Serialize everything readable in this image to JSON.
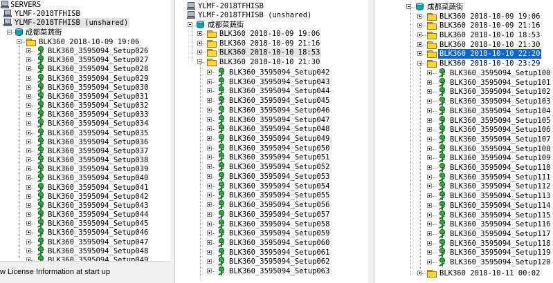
{
  "panel1": {
    "servers_label": "SERVERS",
    "server1": "YLMF-2018TFHISB",
    "server2": "YLMF-2018TFHISB (unshared)",
    "database": "成都菜蔬街",
    "project": "BLK360 2018-10-09 19:06",
    "setups": [
      "BLK360_3595094_Setup026",
      "BLK360_3595094_Setup027",
      "BLK360_3595094_Setup028",
      "BLK360_3595094_Setup029",
      "BLK360_3595094_Setup030",
      "BLK360_3595094_Setup031",
      "BLK360_3595094_Setup032",
      "BLK360_3595094_Setup033",
      "BLK360_3595094_Setup034",
      "BLK360_3595094_Setup035",
      "BLK360_3595094_Setup036",
      "BLK360_3595094_Setup037",
      "BLK360_3595094_Setup038",
      "BLK360_3595094_Setup039",
      "BLK360_3595094_Setup040",
      "BLK360_3595094_Setup041",
      "BLK360_3595094_Setup042",
      "BLK360_3595094_Setup043",
      "BLK360_3595094_Setup044",
      "BLK360_3595094_Setup045",
      "BLK360_3595094_Setup046",
      "BLK360_3595094_Setup047",
      "BLK360_3595094_Setup048",
      "BLK360_3595094_Setup049"
    ],
    "license_text": "w License Information at start up"
  },
  "panel2": {
    "server1": "YLMF-2018TFHISB",
    "server2": "YLMF-2018TFHISB (unshared)",
    "database": "成都菜蔬街",
    "projects": [
      "BLK360 2018-10-09 19:06",
      "BLK360 2018-10-09 21:16",
      "BLK360 2018-10-10 18:53"
    ],
    "open_project": "BLK360 2018-10-10 21:30",
    "setups": [
      "BLK360_3595094_Setup042",
      "BLK360_3595094_Setup043",
      "BLK360_3595094_Setup044",
      "BLK360_3595094_Setup045",
      "BLK360_3595094_Setup046",
      "BLK360_3595094_Setup047",
      "BLK360_3595094_Setup048",
      "BLK360_3595094_Setup049",
      "BLK360_3595094_Setup050",
      "BLK360_3595094_Setup051",
      "BLK360_3595094_Setup052",
      "BLK360_3595094_Setup053",
      "BLK360_3595094_Setup054",
      "BLK360_3595094_Setup055",
      "BLK360_3595094_Setup056",
      "BLK360_3595094_Setup057",
      "BLK360_3595094_Setup058",
      "BLK360_3595094_Setup059",
      "BLK360_3595094_Setup060",
      "BLK360_3595094_Setup061",
      "BLK360_3595094_Setup062",
      "BLK360_3595094_Setup063"
    ]
  },
  "panel3": {
    "database": "成都菜蔬街",
    "projects": [
      "BLK360 2018-10-09 19:06",
      "BLK360 2018-10-09 21:16",
      "BLK360 2018-10-10 18:53",
      "BLK360 2018-10-10 21:30",
      "BLK360 2018-10-10 22:20"
    ],
    "open_project": "BLK360 2018-10-10 23:29",
    "setups": [
      "BLK360_3595094_Setup100",
      "BLK360_3595094_Setup101",
      "BLK360_3595094_Setup102",
      "BLK360_3595094_Setup103",
      "BLK360_3595094_Setup104",
      "BLK360_3595094_Setup105",
      "BLK360_3595094_Setup106",
      "BLK360_3595094_Setup107",
      "BLK360_3595094_Setup108",
      "BLK360_3595094_Setup109",
      "BLK360_3595094_Setup110",
      "BLK360_3595094_Setup111",
      "BLK360_3595094_Setup112",
      "BLK360_3595094_Setup113",
      "BLK360_3595094_Setup114",
      "BLK360_3595094_Setup115",
      "BLK360_3595094_Setup116",
      "BLK360_3595094_Setup117",
      "BLK360_3595094_Setup118",
      "BLK360_3595094_Setup119",
      "BLK360_3595094_Setup120"
    ],
    "last_project": "BLK360 2018-10-11 00:02"
  },
  "colors": {
    "selection": "#0a64d8",
    "folder": "#ffd633",
    "database": "#14a0b8",
    "scanner": "#2ea83e"
  }
}
